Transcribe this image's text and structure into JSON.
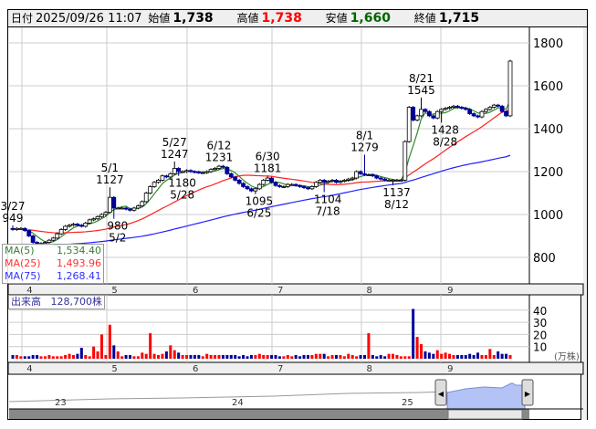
{
  "header": {
    "date_label": "日付",
    "datetime": "2025/09/26 11:07",
    "open_label": "始値",
    "open": "1,738",
    "high_label": "高値",
    "high": "1,738",
    "low_label": "安値",
    "low": "1,660",
    "close_label": "終値",
    "close": "1,715"
  },
  "colors": {
    "up": "#ff0000",
    "down": "#000099",
    "high": "#ff0000",
    "low": "#006600",
    "ma5": "#2e8b2e",
    "ma25": "#ff2020",
    "ma75": "#2020ff",
    "nav_fill": "#b4c3f5"
  },
  "legend": [
    {
      "label": "MA(5)",
      "value": "1,534.40",
      "color": "#3a7d3a"
    },
    {
      "label": "MA(25)",
      "value": "1,493.96",
      "color": "#ff3030"
    },
    {
      "label": "MA(75)",
      "value": "1,268.41",
      "color": "#3030ff"
    }
  ],
  "volume_label": "出来高",
  "volume_value": "128,700株",
  "volume_unit": "(万株)",
  "months": [
    "4",
    "5",
    "6",
    "7",
    "8",
    "9"
  ],
  "month_days": [
    3,
    24,
    44,
    65,
    87,
    107
  ],
  "nav_years": [
    "23",
    "24",
    "25"
  ],
  "price_ticks": [
    800,
    1000,
    1200,
    1400,
    1600,
    1800
  ],
  "volume_ticks": [
    10,
    20,
    30,
    40
  ],
  "chart_data": {
    "type": "candlestick",
    "ma75_seed": 850,
    "closes": [
      930,
      935,
      935,
      925,
      900,
      870,
      860,
      865,
      870,
      880,
      890,
      910,
      930,
      945,
      950,
      955,
      950,
      945,
      960,
      975,
      980,
      990,
      1000,
      1010,
      1080,
      1030,
      1030,
      1030,
      1025,
      1020,
      1030,
      1040,
      1060,
      1100,
      1130,
      1150,
      1160,
      1180,
      1175,
      1190,
      1215,
      1200,
      1200,
      1205,
      1200,
      1198,
      1195,
      1195,
      1200,
      1210,
      1215,
      1225,
      1220,
      1190,
      1175,
      1160,
      1145,
      1130,
      1120,
      1110,
      1120,
      1140,
      1160,
      1170,
      1150,
      1135,
      1130,
      1130,
      1140,
      1140,
      1135,
      1130,
      1125,
      1120,
      1130,
      1150,
      1160,
      1150,
      1155,
      1160,
      1150,
      1155,
      1160,
      1165,
      1170,
      1200,
      1190,
      1185,
      1185,
      1180,
      1170,
      1165,
      1160,
      1160,
      1160,
      1160,
      1160,
      1340,
      1500,
      1440,
      1460,
      1490,
      1480,
      1460,
      1450,
      1480,
      1490,
      1495,
      1500,
      1505,
      1500,
      1495,
      1490,
      1470,
      1460,
      1455,
      1480,
      1490,
      1500,
      1510,
      1505,
      1480,
      1460,
      1715
    ],
    "volumes": [
      3,
      3,
      2,
      2,
      2,
      3,
      3,
      2,
      2,
      3,
      2,
      2,
      2,
      3,
      4,
      3,
      4,
      9,
      3,
      2,
      10,
      6,
      20,
      3,
      28,
      11,
      6,
      2,
      3,
      3,
      2,
      2,
      5,
      4,
      21,
      4,
      3,
      4,
      6,
      11,
      7,
      5,
      3,
      3,
      3,
      3,
      3,
      2,
      4,
      3,
      3,
      3,
      3,
      3,
      3,
      3,
      2,
      3,
      2,
      3,
      3,
      4,
      3,
      3,
      3,
      3,
      2,
      2,
      3,
      2,
      3,
      2,
      3,
      3,
      3,
      4,
      4,
      4,
      2,
      3,
      3,
      3,
      2,
      4,
      3,
      2,
      3,
      3,
      21,
      3,
      2,
      3,
      2,
      4,
      4,
      3,
      2,
      2,
      2,
      41,
      18,
      12,
      6,
      5,
      4,
      7,
      4,
      5,
      4,
      3,
      3,
      3,
      3,
      4,
      3,
      5,
      3,
      3,
      8,
      3,
      6,
      4,
      4,
      3,
      3,
      13
    ],
    "annotations": [
      {
        "i": 0,
        "date": "3/27",
        "value": "949",
        "pos": "above"
      },
      {
        "i": 24,
        "date": "5/1",
        "value": "1127",
        "pos": "above"
      },
      {
        "i": 25,
        "date": "5/2",
        "value": "980",
        "pos": "below"
      },
      {
        "i": 40,
        "date": "5/27",
        "value": "1247",
        "pos": "above"
      },
      {
        "i": 41,
        "date": "5/28",
        "value": "1180",
        "pos": "below"
      },
      {
        "i": 51,
        "date": "6/12",
        "value": "1231",
        "pos": "above"
      },
      {
        "i": 60,
        "date": "6/25",
        "value": "1095",
        "pos": "below"
      },
      {
        "i": 63,
        "date": "6/30",
        "value": "1181",
        "pos": "above"
      },
      {
        "i": 77,
        "date": "7/18",
        "value": "1104",
        "pos": "below"
      },
      {
        "i": 87,
        "date": "8/1",
        "value": "1279",
        "pos": "above"
      },
      {
        "i": 94,
        "date": "8/12",
        "value": "1137",
        "pos": "below"
      },
      {
        "i": 101,
        "date": "8/21",
        "value": "1545",
        "pos": "above"
      },
      {
        "i": 106,
        "date": "8/28",
        "value": "1428",
        "pos": "below"
      },
      {
        "i": 125,
        "date": "9/26",
        "value": "1738",
        "pos": "above",
        "open": 1738,
        "low": 1660
      }
    ]
  }
}
